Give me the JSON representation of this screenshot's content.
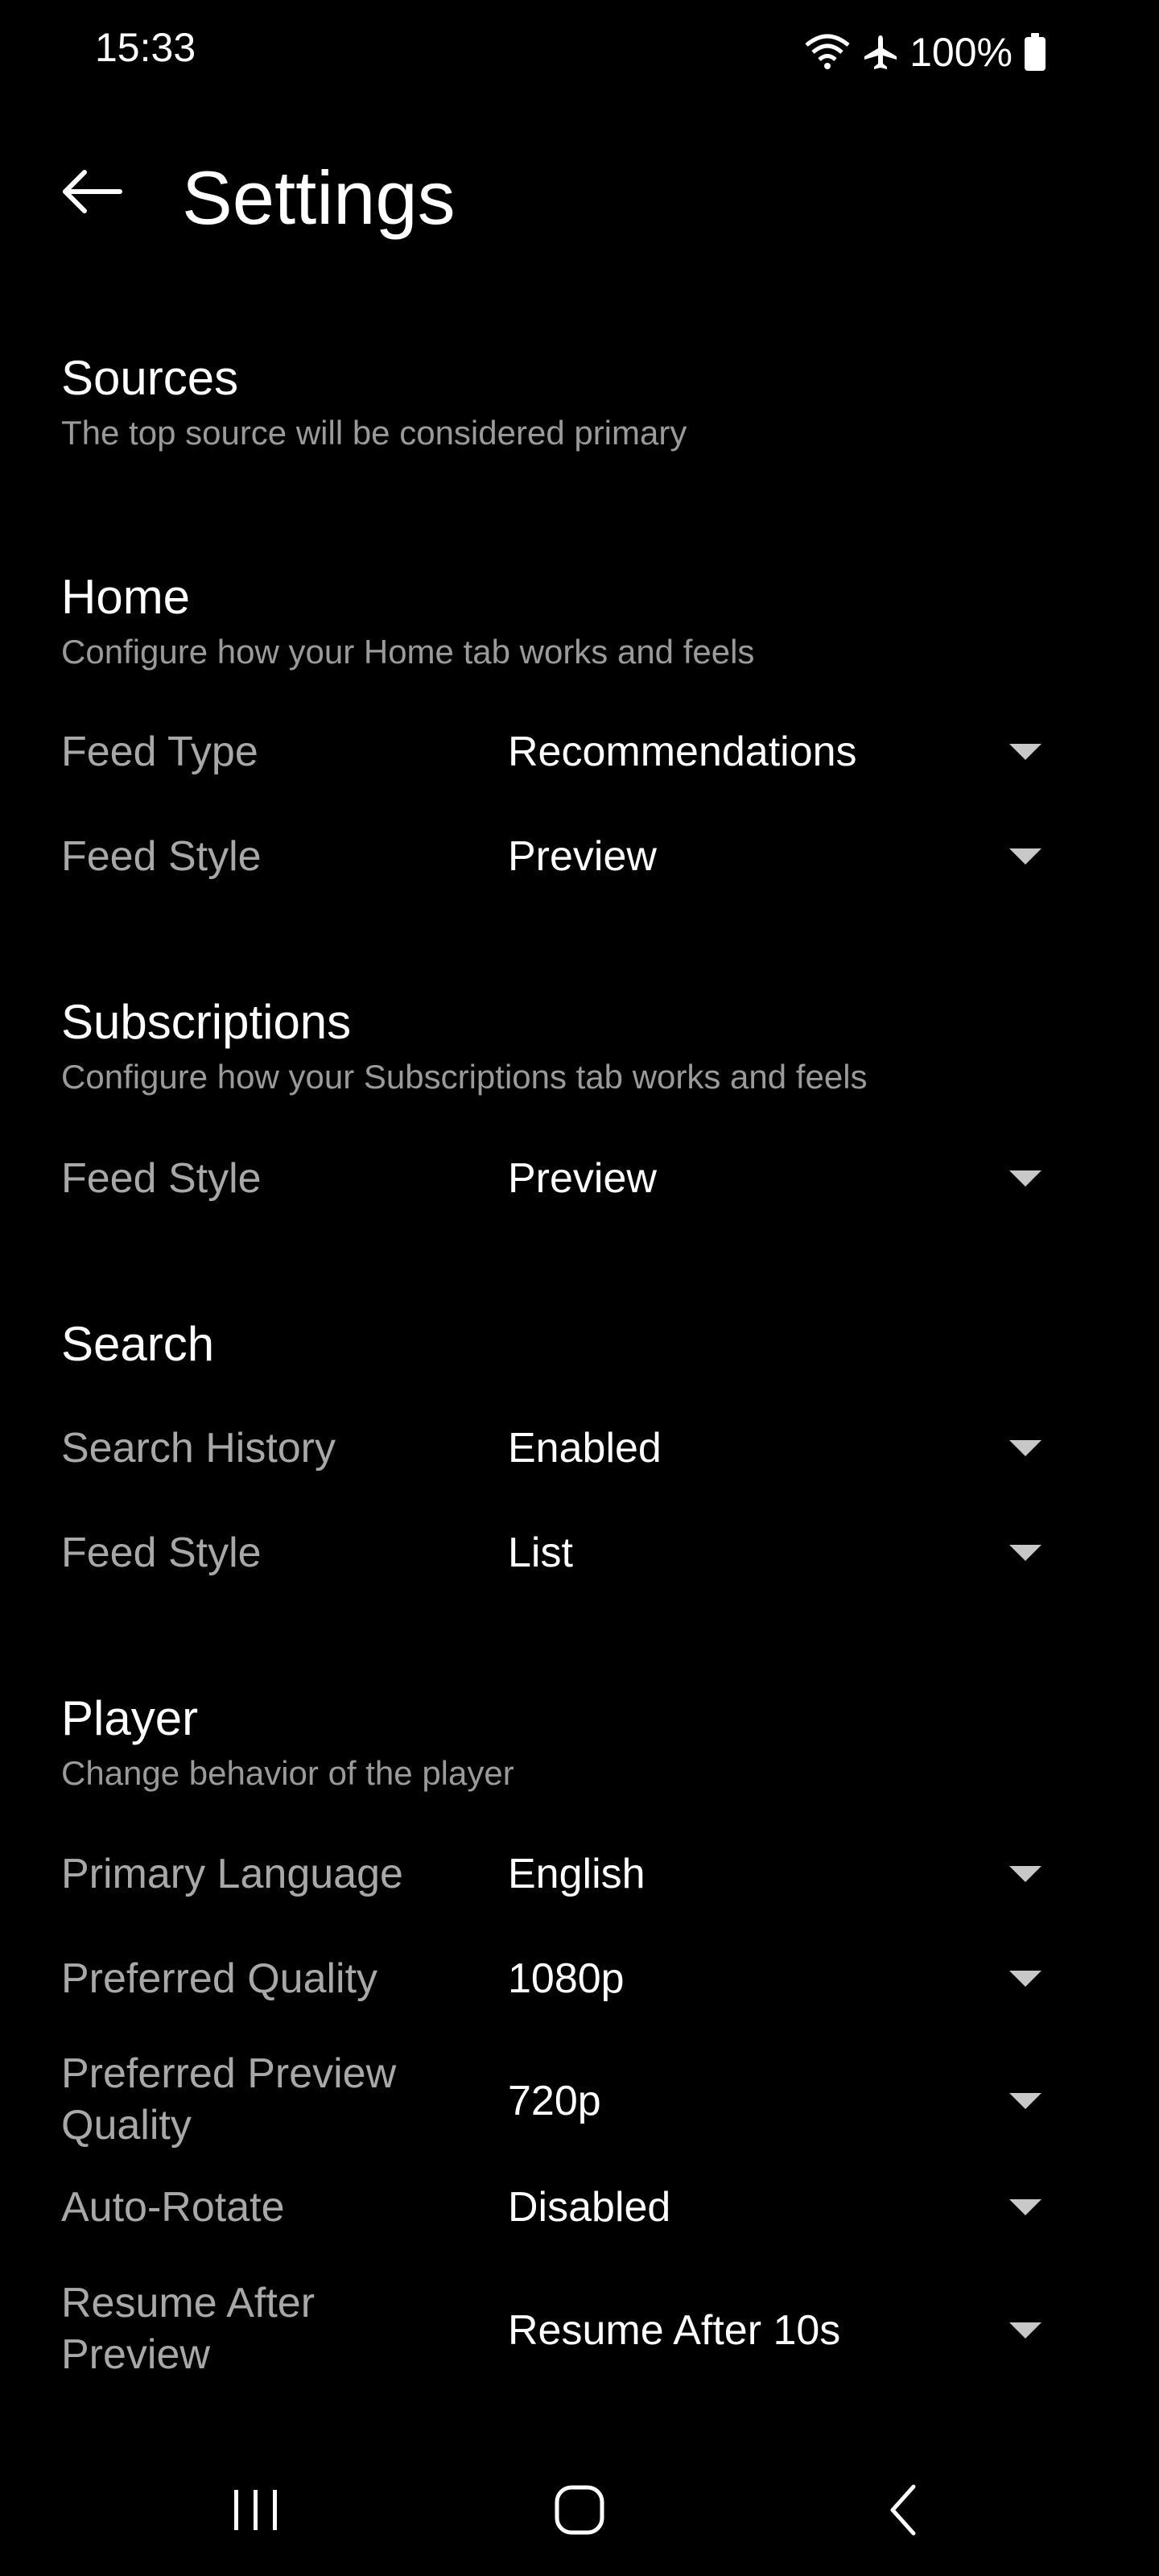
{
  "status_bar": {
    "time": "15:33",
    "battery": "100%",
    "icons": [
      "wifi-icon",
      "airplane-icon",
      "battery-icon"
    ]
  },
  "header": {
    "title": "Settings",
    "back_icon": "arrow-left-icon"
  },
  "sections": {
    "sources": {
      "title": "Sources",
      "description": "The top source will be considered primary"
    },
    "home": {
      "title": "Home",
      "description": "Configure how your Home tab works and feels",
      "rows": [
        {
          "label": "Feed Type",
          "value": "Recommendations"
        },
        {
          "label": "Feed Style",
          "value": "Preview"
        }
      ]
    },
    "subscriptions": {
      "title": "Subscriptions",
      "description": "Configure how your Subscriptions tab works and feels",
      "rows": [
        {
          "label": "Feed Style",
          "value": "Preview"
        }
      ]
    },
    "search": {
      "title": "Search",
      "rows": [
        {
          "label": "Search History",
          "value": "Enabled"
        },
        {
          "label": "Feed Style",
          "value": "List"
        }
      ]
    },
    "player": {
      "title": "Player",
      "description": "Change behavior of the player",
      "rows": [
        {
          "label": "Primary Language",
          "value": "English"
        },
        {
          "label": "Preferred Quality",
          "value": "1080p"
        },
        {
          "label": "Preferred Preview Quality",
          "value": "720p"
        },
        {
          "label": "Auto-Rotate",
          "value": "Disabled"
        },
        {
          "label": "Resume After Preview",
          "value": "Resume After 10s"
        }
      ]
    }
  },
  "nav_bar": {
    "icons": [
      "recent-apps-icon",
      "home-icon",
      "back-icon"
    ]
  },
  "colors": {
    "background": "#000000",
    "text_primary": "#ffffff",
    "text_secondary": "#a8a8a8",
    "text_description": "#9a9a9a"
  }
}
